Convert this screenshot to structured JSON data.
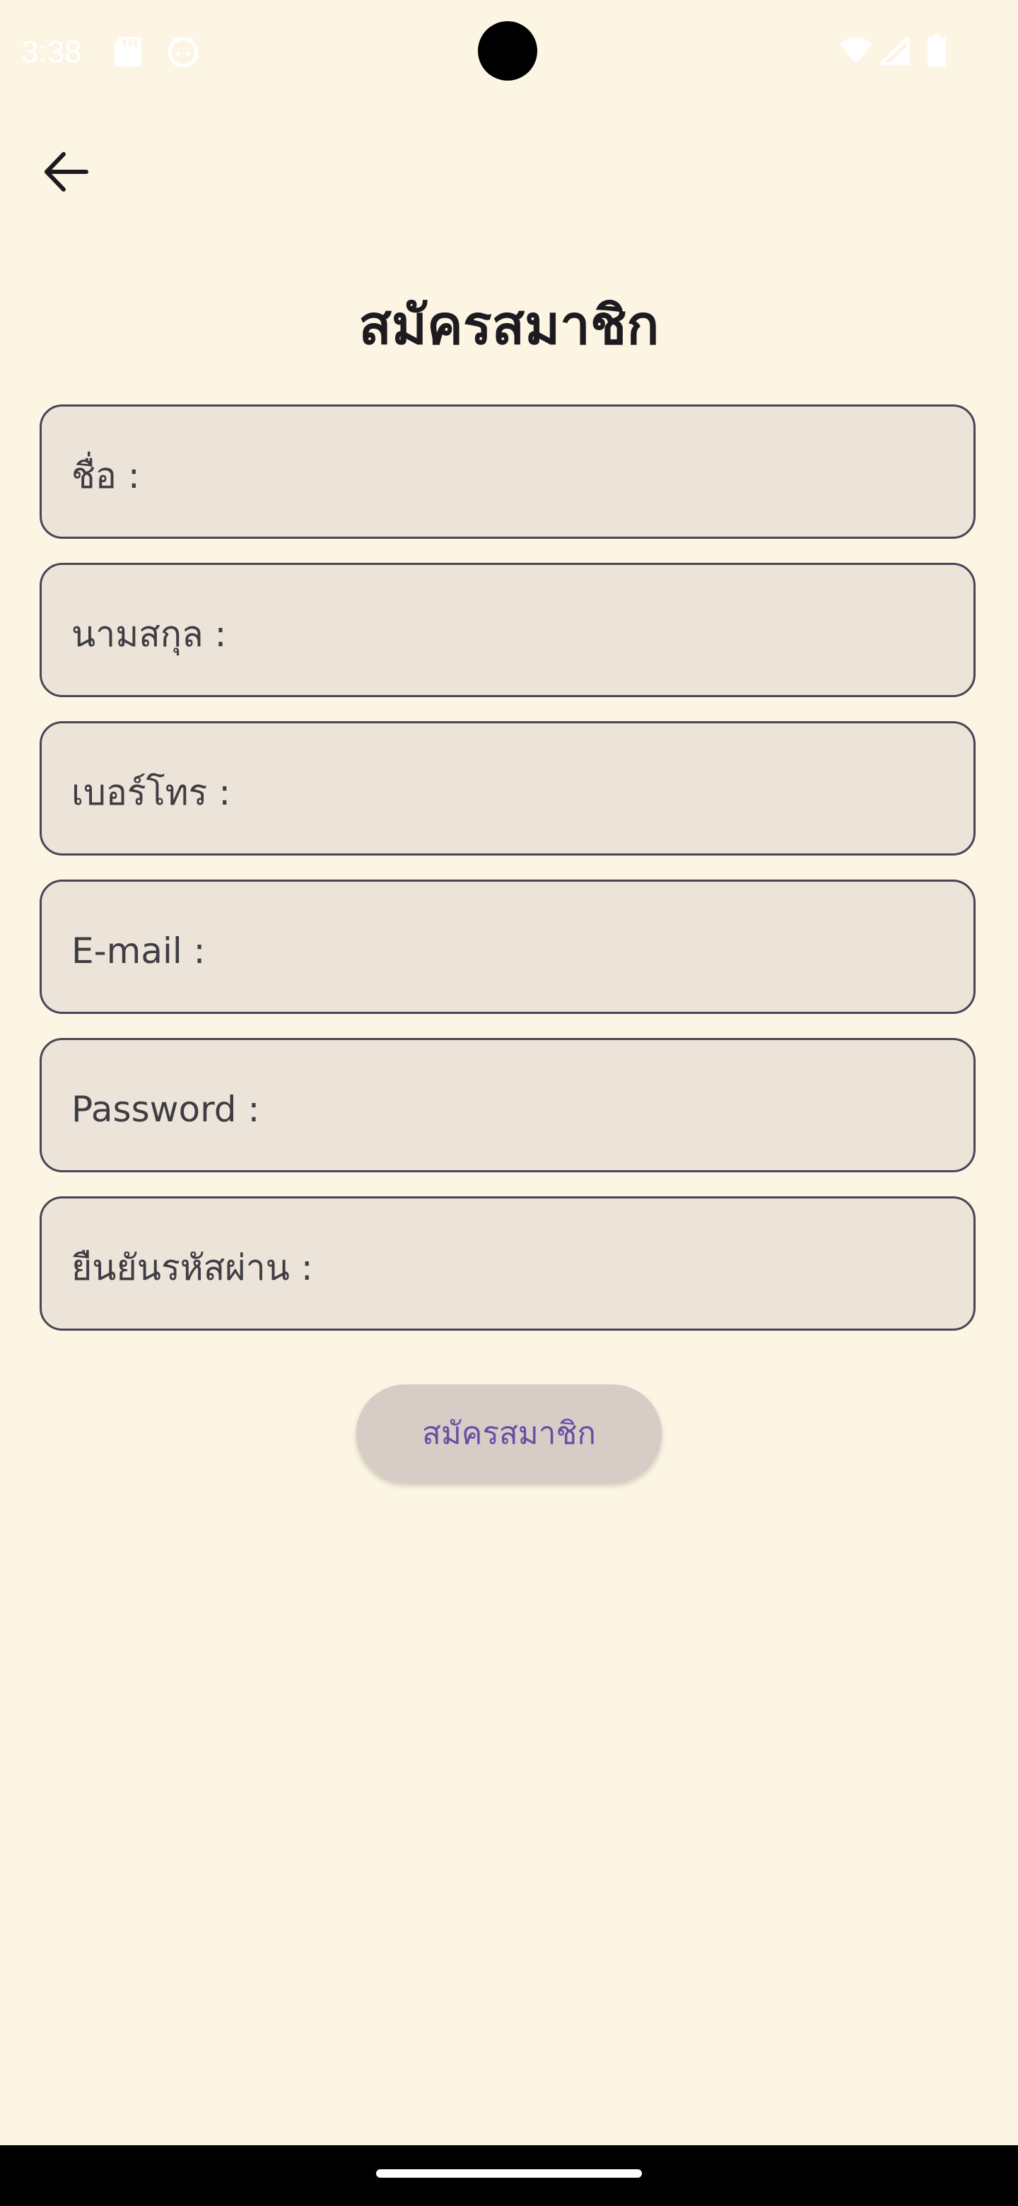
{
  "status_bar": {
    "time": "3:38",
    "icons": [
      "sd-card-icon",
      "android-face-icon",
      "wifi-icon",
      "cellular-signal-icon",
      "battery-icon"
    ]
  },
  "header": {
    "back_icon": "arrow-back-icon",
    "title": "สมัครสมาชิก"
  },
  "form": {
    "fields": [
      {
        "label": "ชื่อ :"
      },
      {
        "label": "นามสกุล :"
      },
      {
        "label": "เบอร์โทร :"
      },
      {
        "label": "E-mail :"
      },
      {
        "label": "Password :"
      },
      {
        "label": "ยืนยันรหัสผ่าน :"
      }
    ],
    "submit_label": "สมัครสมาชิก"
  },
  "colors": {
    "background": "#FCF5E4",
    "field_fill": "#ECE4D8",
    "field_border": "#4A4458",
    "button_fill": "#D7CCC6",
    "button_text": "#6750A4",
    "title_text": "#1D1B20"
  }
}
